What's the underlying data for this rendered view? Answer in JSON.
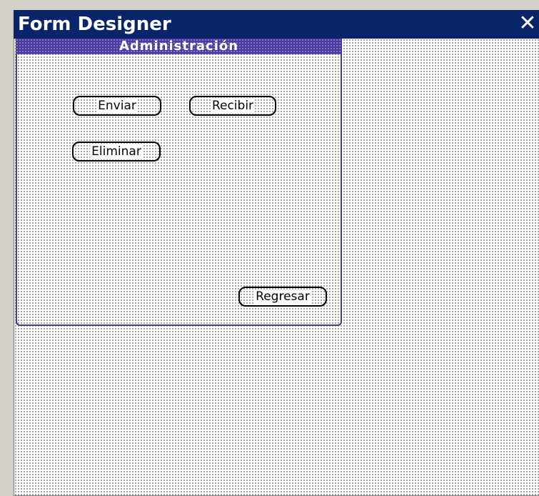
{
  "window": {
    "title": "Form Designer",
    "close_glyph": "✕"
  },
  "form": {
    "title": "Administración",
    "buttons": {
      "enviar": "Enviar",
      "recibir": "Recibir",
      "eliminar": "Eliminar",
      "regresar": "Regresar"
    }
  },
  "colors": {
    "titlebar": "#0a246a",
    "form_title_bar": "#4b3ba0",
    "form_border": "#4b3b8f",
    "canvas_dots": "#8a8a8a"
  }
}
